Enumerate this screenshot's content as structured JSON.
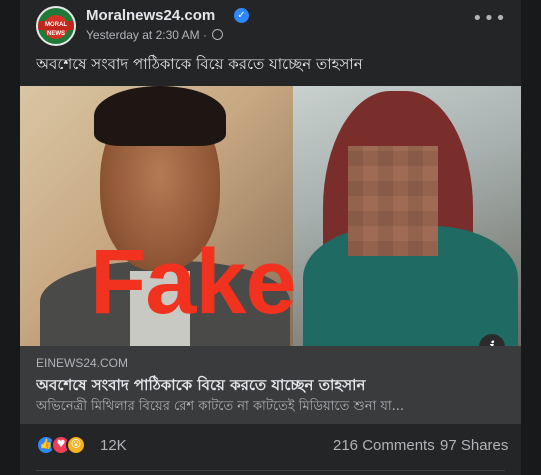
{
  "post": {
    "page_name": "Moralnews24.com",
    "avatar_text": "MORAL NEWS",
    "timestamp": "Yesterday at 2:30 AM",
    "separator": "·",
    "verified_icon": "verified-badge-icon",
    "privacy_icon": "globe-icon",
    "more_label": "•••",
    "caption": "অবশেষে সংবাদ পাঠিকাকে বিয়ে করতে যাচ্ছেন তাহসান"
  },
  "image": {
    "overlay_text": "Fake",
    "info_label": "i"
  },
  "link": {
    "domain": "EINEWS24.COM",
    "title": "অবশেষে সংবাদ পাঠিকাকে বিয়ে করতে যাচ্ছেন তাহসান",
    "description": "অভিনেত্রী মিথিলার বিয়ের রেশ কাটতে না কাটতেই মিডিয়াতে শুনা যা..."
  },
  "stats": {
    "reactions": [
      "like",
      "love",
      "wow"
    ],
    "reaction_count": "12K",
    "comments": "216 Comments",
    "shares": "97 Shares"
  },
  "colors": {
    "background": "#18191a",
    "card": "#242526",
    "link_box": "#3a3b3c",
    "fake_red": "#f1321f",
    "verified_blue": "#2d88ff"
  }
}
